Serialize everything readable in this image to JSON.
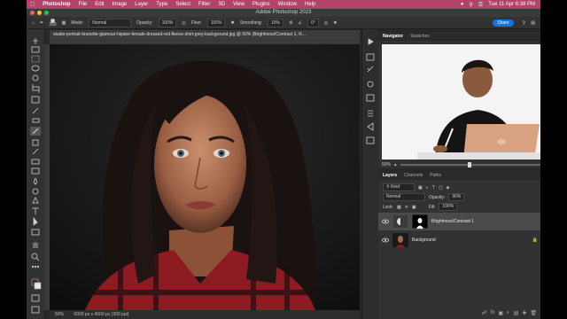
{
  "menubar": {
    "app_name": "Photoshop",
    "items": [
      "File",
      "Edit",
      "Image",
      "Layer",
      "Type",
      "Select",
      "Filter",
      "3D",
      "View",
      "Plugins",
      "Window",
      "Help"
    ],
    "clock": "Tue 11 Apr 6:38 PM"
  },
  "window": {
    "title": "Adobe Photoshop 2023"
  },
  "options_bar": {
    "brush_size": "350",
    "mode_label": "Mode:",
    "mode_value": "Normal",
    "opacity_label": "Opacity:",
    "opacity_value": "100%",
    "flow_label": "Flow:",
    "flow_value": "100%",
    "smoothing_label": "Smoothing:",
    "smoothing_value": "10%",
    "angle_value": "0°",
    "share_label": "Share"
  },
  "document": {
    "tab_title": "studio-portrait-brunette-glamour-hipster-female-dressed-red-fleece-shirt-grey-background.jpg @ 50% (Brightness/Contrast 1, R...",
    "zoom": "50%",
    "dimensions": "6000 px x 4000 px (300 ppi)"
  },
  "navigator": {
    "tabs": [
      "Navigator",
      "Swatches"
    ],
    "active_tab": "Navigator",
    "zoom": "50%"
  },
  "layers": {
    "tabs": [
      "Layers",
      "Channels",
      "Paths"
    ],
    "active_tab": "Layers",
    "filter_value": "Kind",
    "blend_mode": "Normal",
    "opacity_label": "Opacity:",
    "opacity_value": "90%",
    "lock_label": "Lock:",
    "fill_label": "Fill:",
    "fill_value": "100%",
    "items": [
      {
        "name": "Brightness/Contrast 1",
        "selected": true
      },
      {
        "name": "Background",
        "selected": false
      }
    ]
  },
  "colors": {
    "menubar": "#b2426a",
    "panel": "#323232",
    "accent": "#1473e6"
  }
}
